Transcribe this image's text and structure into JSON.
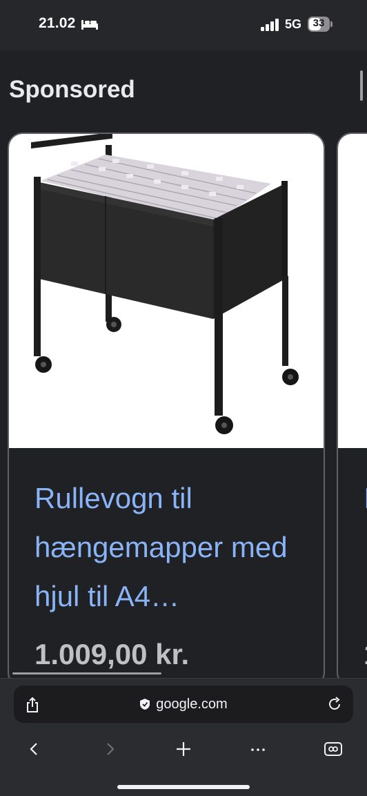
{
  "status_bar": {
    "time": "21.02",
    "network": "5G",
    "battery": "33",
    "battery_level_percent": 33,
    "icons": [
      "bed-icon",
      "signal-icon",
      "battery-icon"
    ]
  },
  "section": {
    "title": "Sponsored"
  },
  "products": [
    {
      "title": "Rullevogn til hængemapper med hjul til A4…",
      "price": "1.009,00 kr.",
      "image": "rolling-file-cart-image"
    },
    {
      "title_visible": "I",
      "price_visible": "1"
    }
  ],
  "browser": {
    "url": "google.com",
    "icons": [
      "share-icon",
      "shield-icon",
      "reload-icon",
      "back-icon",
      "forward-icon",
      "plus-icon",
      "more-icon",
      "tabs-icon"
    ]
  },
  "colors": {
    "background": "#202124",
    "link": "#8ab4f8",
    "price": "#bdc1c6"
  }
}
